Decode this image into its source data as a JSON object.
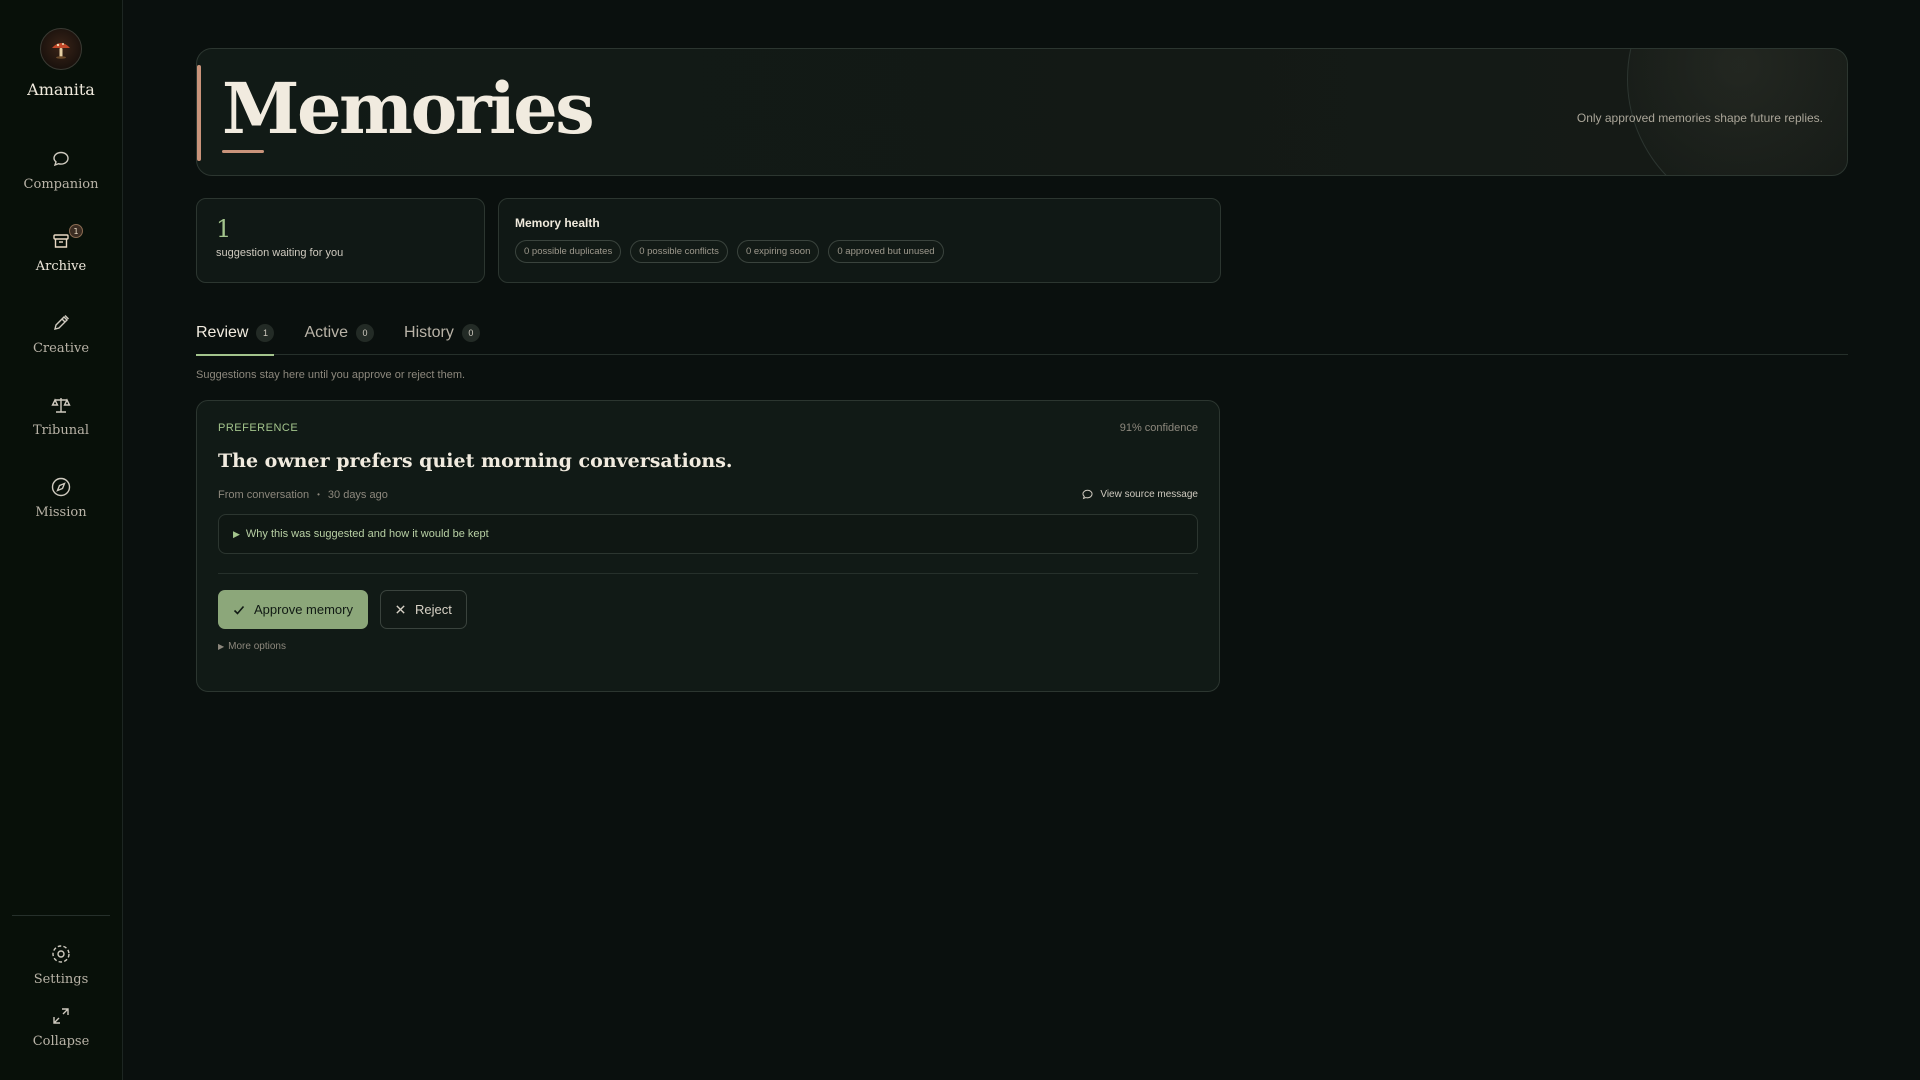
{
  "brand": {
    "name": "Amanita",
    "icon": "mushroom-icon"
  },
  "nav": [
    {
      "label": "Companion",
      "icon": "chat-bubble-icon"
    },
    {
      "label": "Archive",
      "icon": "archive-box-icon",
      "badge": "1",
      "active": true
    },
    {
      "label": "Creative",
      "icon": "pen-icon"
    },
    {
      "label": "Tribunal",
      "icon": "scales-icon"
    },
    {
      "label": "Mission",
      "icon": "compass-icon"
    }
  ],
  "bottom_nav": [
    {
      "label": "Settings",
      "icon": "gear-icon"
    },
    {
      "label": "Collapse",
      "icon": "expand-arrows-icon"
    }
  ],
  "hero": {
    "title": "Memories",
    "subtitle": "Only approved memories shape future replies."
  },
  "stats": {
    "count": "1",
    "label": "suggestion waiting for you"
  },
  "health": {
    "title": "Memory health",
    "chips": [
      "0 possible duplicates",
      "0 possible conflicts",
      "0 expiring soon",
      "0 approved but unused"
    ]
  },
  "tabs": [
    {
      "label": "Review",
      "count": "1",
      "active": true
    },
    {
      "label": "Active",
      "count": "0"
    },
    {
      "label": "History",
      "count": "0"
    }
  ],
  "tab_hint": "Suggestions stay here until you approve or reject them.",
  "suggestion": {
    "kind": "PREFERENCE",
    "confidence": "91% confidence",
    "text": "The owner prefers quiet morning conversations.",
    "source": "From conversation",
    "age": "30 days ago",
    "view_source": "View source message",
    "why": "Why this was suggested and how it would be kept",
    "approve": "Approve memory",
    "reject": "Reject",
    "more": "More options"
  },
  "colors": {
    "accent_green": "#a3c48c",
    "approve_bg": "#8ca77a",
    "accent_copper": "#c9937a",
    "background": "#0a100e"
  }
}
